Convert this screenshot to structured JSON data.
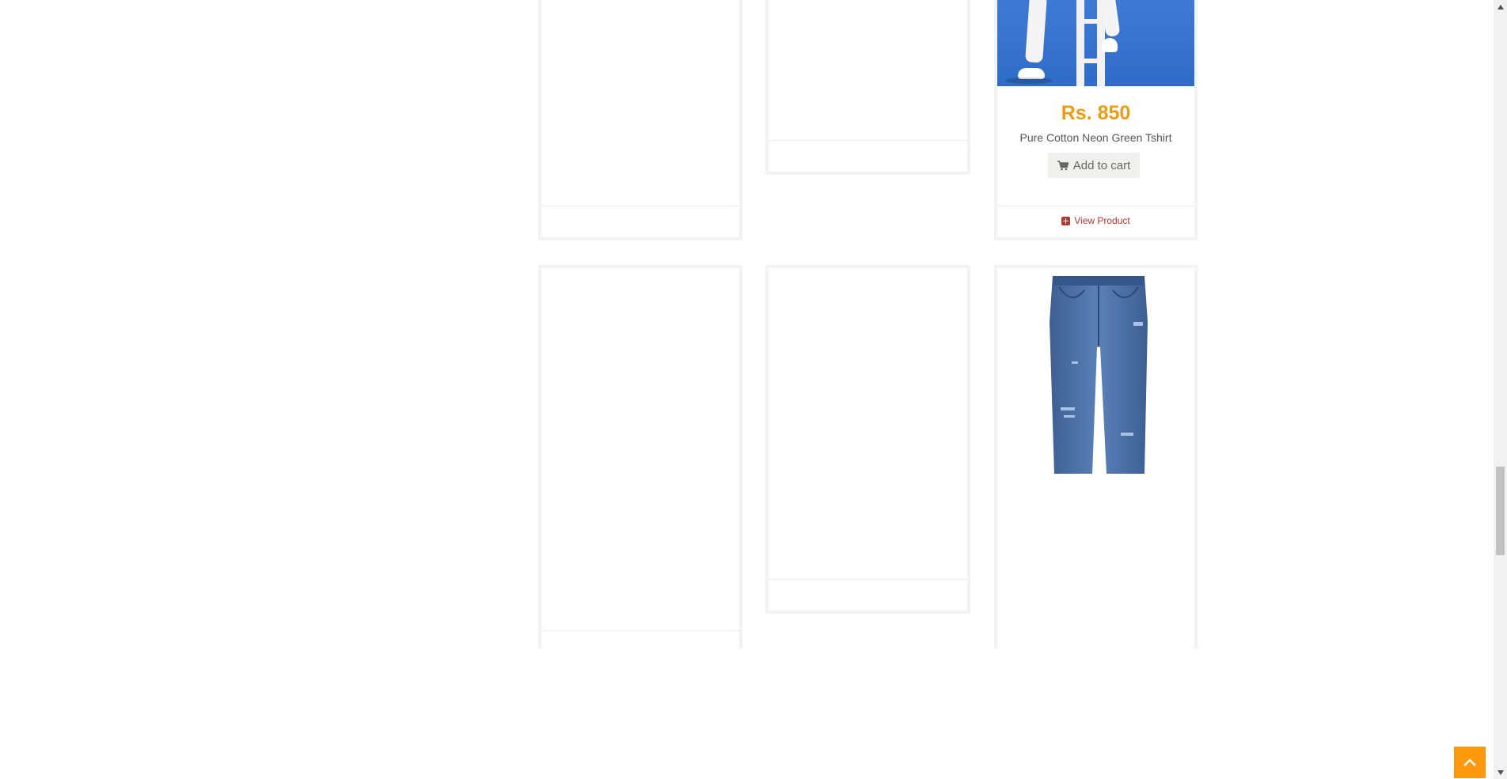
{
  "products": [
    {
      "price": "Rs. 850",
      "name": "Pure Cotton Neon Green Tshirt",
      "add_to_cart_label": "Add to cart",
      "view_product_label": "View Product"
    }
  ],
  "icons": {
    "cart": "shopping-cart-icon",
    "view": "plus-square-icon",
    "scroll_to_top": "chevron-up-icon"
  },
  "colors": {
    "price": "#ef9b0f",
    "view_link": "#b3372c",
    "scroll_to_top_bg": "#fe980f",
    "button_bg": "#f0f0ed"
  }
}
